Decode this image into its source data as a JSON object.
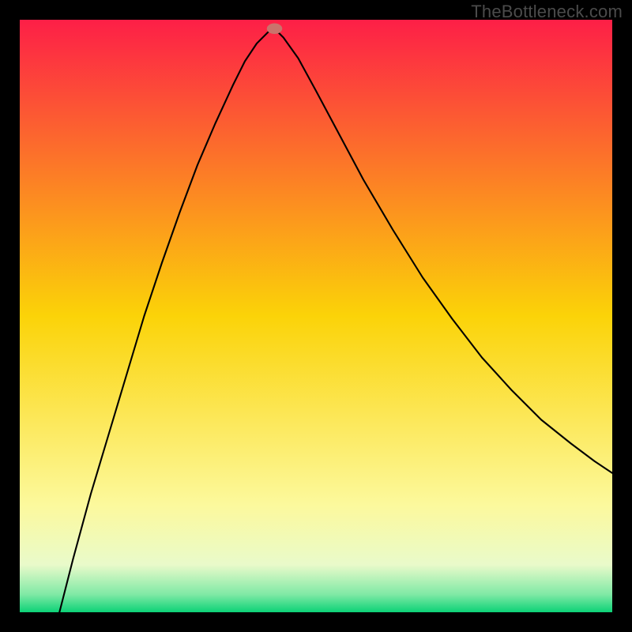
{
  "watermark": "TheBottleneck.com",
  "chart_data": {
    "type": "line",
    "title": "",
    "xlabel": "",
    "ylabel": "",
    "xlim": [
      0,
      100
    ],
    "ylim": [
      0,
      100
    ],
    "background_gradient": {
      "stops": [
        {
          "offset": 0.0,
          "color": "#fd1f47"
        },
        {
          "offset": 0.5,
          "color": "#fbd308"
        },
        {
          "offset": 0.82,
          "color": "#fcf99d"
        },
        {
          "offset": 0.92,
          "color": "#e9faca"
        },
        {
          "offset": 0.97,
          "color": "#7fe9a5"
        },
        {
          "offset": 1.0,
          "color": "#0cd277"
        }
      ]
    },
    "marker": {
      "x": 43,
      "y": 98.5,
      "rx": 1.3,
      "ry": 0.9,
      "color": "#c9736c"
    },
    "curve_left": [
      {
        "x": 6.7,
        "y": 0.0
      },
      {
        "x": 9.0,
        "y": 9.0
      },
      {
        "x": 12.0,
        "y": 20.0
      },
      {
        "x": 15.0,
        "y": 30.0
      },
      {
        "x": 18.0,
        "y": 40.0
      },
      {
        "x": 21.0,
        "y": 50.0
      },
      {
        "x": 24.0,
        "y": 59.0
      },
      {
        "x": 27.0,
        "y": 67.5
      },
      {
        "x": 30.0,
        "y": 75.5
      },
      {
        "x": 33.0,
        "y": 82.5
      },
      {
        "x": 36.0,
        "y": 89.0
      },
      {
        "x": 38.0,
        "y": 93.0
      },
      {
        "x": 40.0,
        "y": 96.0
      },
      {
        "x": 42.0,
        "y": 98.0
      },
      {
        "x": 43.0,
        "y": 98.5
      }
    ],
    "curve_right": [
      {
        "x": 43.0,
        "y": 98.5
      },
      {
        "x": 44.5,
        "y": 97.0
      },
      {
        "x": 47.0,
        "y": 93.5
      },
      {
        "x": 50.0,
        "y": 88.0
      },
      {
        "x": 54.0,
        "y": 80.5
      },
      {
        "x": 58.0,
        "y": 73.0
      },
      {
        "x": 63.0,
        "y": 64.5
      },
      {
        "x": 68.0,
        "y": 56.5
      },
      {
        "x": 73.0,
        "y": 49.5
      },
      {
        "x": 78.0,
        "y": 43.0
      },
      {
        "x": 83.0,
        "y": 37.5
      },
      {
        "x": 88.0,
        "y": 32.5
      },
      {
        "x": 93.0,
        "y": 28.5
      },
      {
        "x": 97.0,
        "y": 25.5
      },
      {
        "x": 100.0,
        "y": 23.5
      }
    ]
  }
}
